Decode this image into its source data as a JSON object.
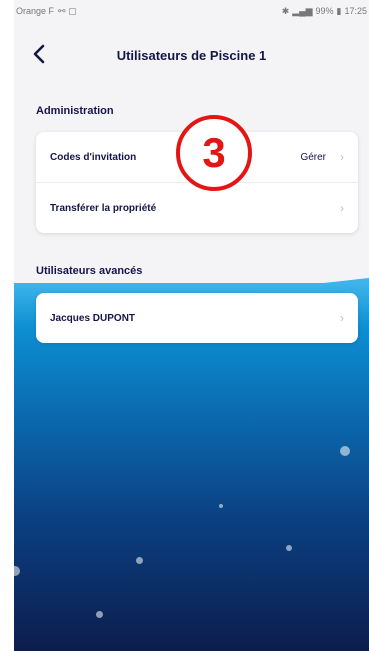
{
  "status_bar": {
    "carrier": "Orange F",
    "battery": "99%",
    "time": "17:25"
  },
  "header": {
    "title": "Utilisateurs de Piscine 1"
  },
  "annotation": {
    "number": "3"
  },
  "sections": {
    "administration": {
      "title": "Administration",
      "rows": [
        {
          "label": "Codes d'invitation",
          "value": "Gérer"
        },
        {
          "label": "Transférer la propriété",
          "value": ""
        }
      ]
    },
    "advanced_users": {
      "title": "Utilisateurs avancés",
      "rows": [
        {
          "label": "Jacques DUPONT"
        }
      ]
    }
  },
  "icons": {
    "back": "chevron-left-icon",
    "row_chevron": "chevron-right-icon"
  },
  "colors": {
    "title": "#15154a",
    "annotation": "#e31515",
    "background": "#f4f4f6",
    "water_top": "#3fb4ea",
    "water_bottom": "#0c1d4c"
  }
}
